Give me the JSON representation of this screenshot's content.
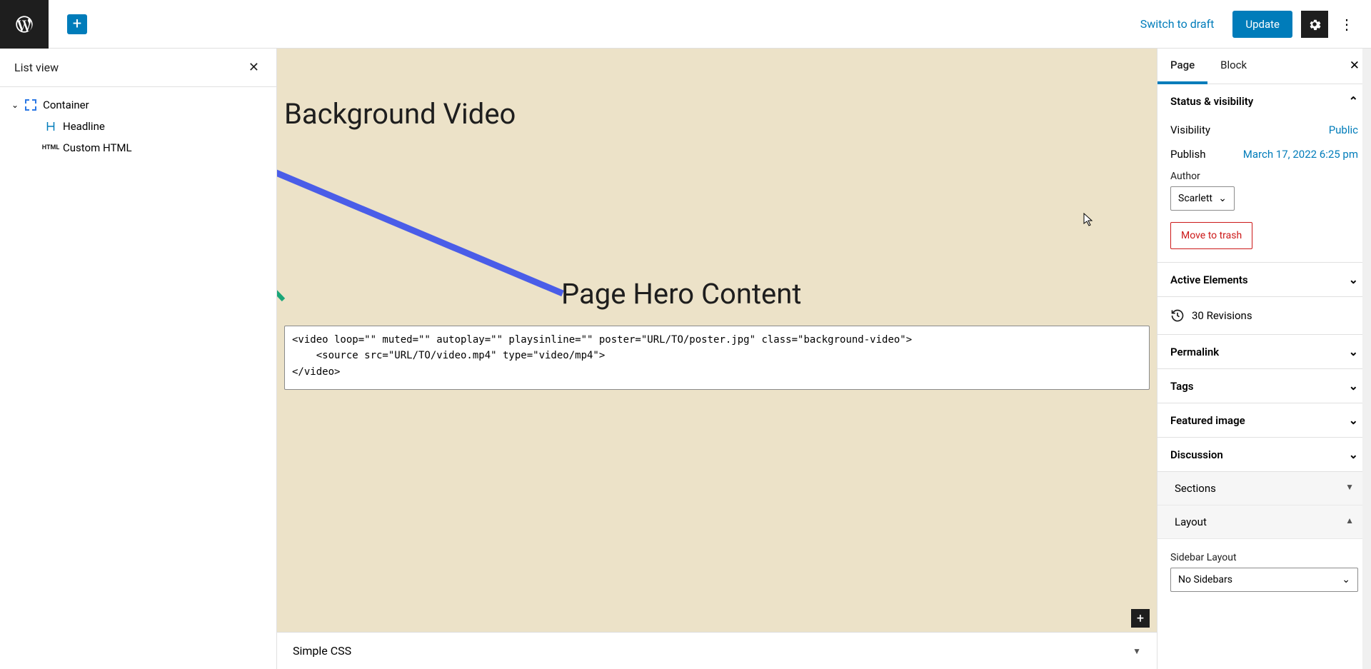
{
  "toolbar": {
    "switch_draft": "Switch to draft",
    "update": "Update"
  },
  "list_view": {
    "title": "List view",
    "items": [
      {
        "label": "Container"
      },
      {
        "label": "Headline"
      },
      {
        "label": "Custom HTML"
      }
    ]
  },
  "canvas": {
    "page_title": "Background Video",
    "hero_text": "Page Hero Content",
    "html_code": "<video loop=\"\" muted=\"\" autoplay=\"\" playsinline=\"\" poster=\"URL/TO/poster.jpg\" class=\"background-video\">\n    <source src=\"URL/TO/video.mp4\" type=\"video/mp4\">\n</video>",
    "simple_css": "Simple CSS"
  },
  "sidebar": {
    "tabs": {
      "page": "Page",
      "block": "Block"
    },
    "status": {
      "title": "Status & visibility",
      "visibility_label": "Visibility",
      "visibility_value": "Public",
      "publish_label": "Publish",
      "publish_value": "March 17, 2022 6:25 pm",
      "author_label": "Author",
      "author_value": "Scarlett",
      "trash": "Move to trash"
    },
    "panels": {
      "active_elements": "Active Elements",
      "revisions": "30 Revisions",
      "permalink": "Permalink",
      "tags": "Tags",
      "featured_image": "Featured image",
      "discussion": "Discussion",
      "sections": "Sections",
      "layout": "Layout",
      "sidebar_layout_label": "Sidebar Layout",
      "sidebar_layout_value": "No Sidebars"
    }
  }
}
